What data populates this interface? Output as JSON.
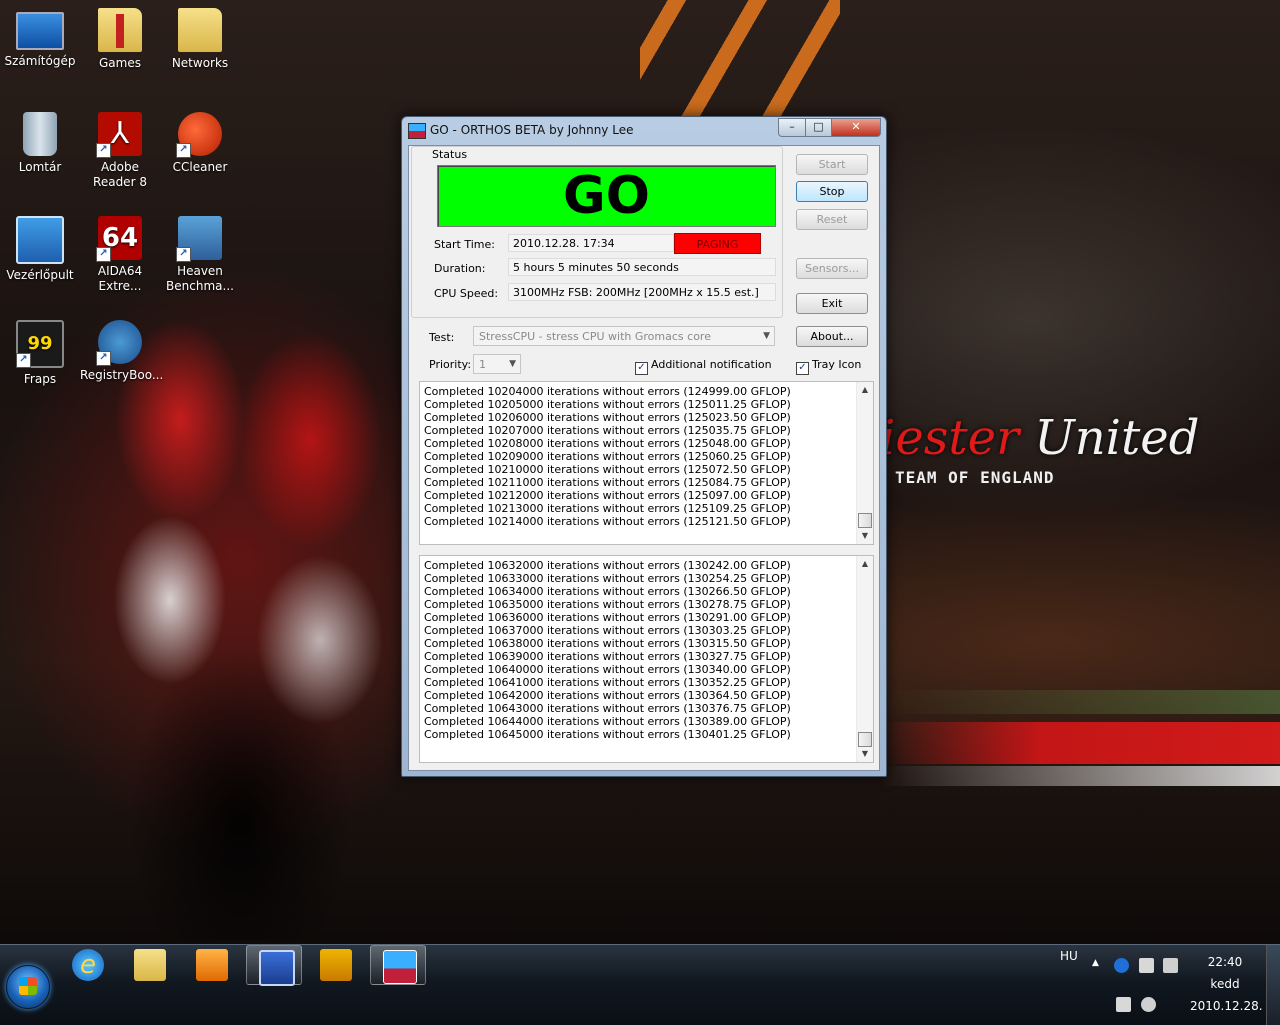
{
  "desktop": {
    "icons": [
      {
        "label": "Számítógép"
      },
      {
        "label": "Games"
      },
      {
        "label": "Networks"
      },
      {
        "label": "Lomtár"
      },
      {
        "label": "Adobe Reader 8"
      },
      {
        "label": "CCleaner"
      },
      {
        "label": "Vezérlőpult"
      },
      {
        "label": "AIDA64 Extre..."
      },
      {
        "label": "Heaven Benchma..."
      },
      {
        "label": "Fraps"
      },
      {
        "label": "RegistryBoo..."
      }
    ],
    "wallpaper": {
      "text_red": "iester",
      "text_white": " United",
      "subtitle": "TEAM OF ENGLAND",
      "accent": "#c31616"
    }
  },
  "window": {
    "title": "GO - ORTHOS BETA by Johnny Lee",
    "controls": {
      "minimize": "–",
      "maximize": "□",
      "close": "✕"
    },
    "status": {
      "legend": "Status",
      "indicator": "GO",
      "indicator_color": "#00ff00",
      "start_time_label": "Start Time:",
      "start_time": "2010.12.28.  17:34",
      "paging": "PAGING",
      "paging_color": "#ff0000",
      "duration_label": "Duration:",
      "duration": "5 hours 5 minutes 50 seconds",
      "cpu_speed_label": "CPU Speed:",
      "cpu_speed": "3100MHz FSB: 200MHz [200MHz x 15.5 est.]"
    },
    "buttons": {
      "start": "Start",
      "stop": "Stop",
      "reset": "Reset",
      "sensors": "Sensors...",
      "exit": "Exit",
      "about": "About..."
    },
    "test": {
      "label": "Test:",
      "value": "StressCPU - stress CPU with Gromacs core"
    },
    "priority": {
      "label": "Priority:",
      "value": "1"
    },
    "additional_notification": {
      "label": "Additional notification",
      "checked": true
    },
    "tray_icon": {
      "label": "Tray Icon",
      "checked": true
    },
    "log1": [
      "Completed 10204000 iterations without errors (124999.00 GFLOP)",
      "Completed 10205000 iterations without errors (125011.25 GFLOP)",
      "Completed 10206000 iterations without errors (125023.50 GFLOP)",
      "Completed 10207000 iterations without errors (125035.75 GFLOP)",
      "Completed 10208000 iterations without errors (125048.00 GFLOP)",
      "Completed 10209000 iterations without errors (125060.25 GFLOP)",
      "Completed 10210000 iterations without errors (125072.50 GFLOP)",
      "Completed 10211000 iterations without errors (125084.75 GFLOP)",
      "Completed 10212000 iterations without errors (125097.00 GFLOP)",
      "Completed 10213000 iterations without errors (125109.25 GFLOP)",
      "Completed 10214000 iterations without errors (125121.50 GFLOP)"
    ],
    "log2": [
      "Completed 10632000 iterations without errors (130242.00 GFLOP)",
      "Completed 10633000 iterations without errors (130254.25 GFLOP)",
      "Completed 10634000 iterations without errors (130266.50 GFLOP)",
      "Completed 10635000 iterations without errors (130278.75 GFLOP)",
      "Completed 10636000 iterations without errors (130291.00 GFLOP)",
      "Completed 10637000 iterations without errors (130303.25 GFLOP)",
      "Completed 10638000 iterations without errors (130315.50 GFLOP)",
      "Completed 10639000 iterations without errors (130327.75 GFLOP)",
      "Completed 10640000 iterations without errors (130340.00 GFLOP)",
      "Completed 10641000 iterations without errors (130352.25 GFLOP)",
      "Completed 10642000 iterations without errors (130364.50 GFLOP)",
      "Completed 10643000 iterations without errors (130376.75 GFLOP)",
      "Completed 10644000 iterations without errors (130389.00 GFLOP)",
      "Completed 10645000 iterations without errors (130401.25 GFLOP)"
    ]
  },
  "taskbar": {
    "pinned": [
      "ie-icon",
      "explorer-icon",
      "media-center-icon",
      "save-icon",
      "winamp-icon",
      "orthos-icon"
    ],
    "language": "HU",
    "clock": {
      "time": "22:40",
      "day": "kedd",
      "date": "2010.12.28."
    }
  }
}
